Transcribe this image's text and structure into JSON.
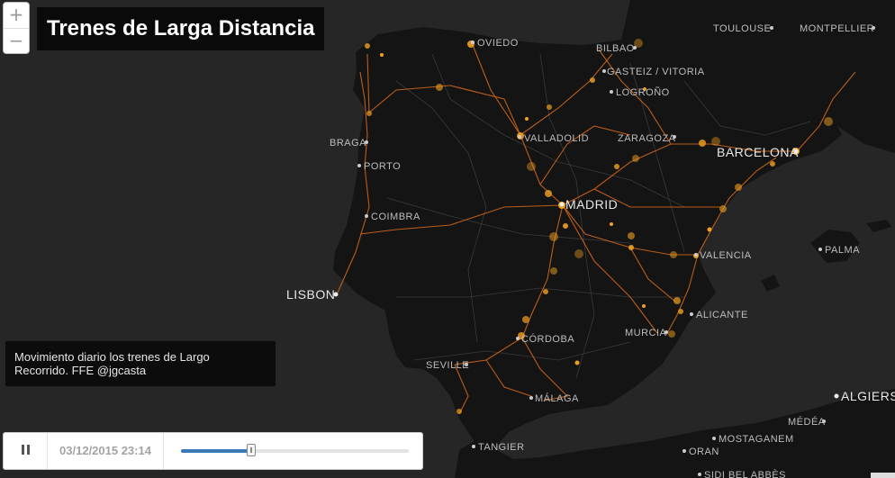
{
  "map": {
    "title": "Trenes de Larga Distancia",
    "caption": "Movimiento diario los trenes de Largo Recorrido. FFE @jgcasta",
    "colors": {
      "sea": "#262626",
      "land": "#141414",
      "railway": "#d96a1a",
      "train_dot": "#f0a020"
    },
    "cities": [
      {
        "name": "OVIEDO",
        "size": "normal"
      },
      {
        "name": "BILBAO",
        "size": "normal"
      },
      {
        "name": "GASTEIZ / VITORIA",
        "size": "normal"
      },
      {
        "name": "LOGROÑO",
        "size": "normal"
      },
      {
        "name": "TOULOUSE",
        "size": "normal"
      },
      {
        "name": "MONTPELLIER",
        "size": "normal"
      },
      {
        "name": "BRAGA",
        "size": "normal"
      },
      {
        "name": "PORTO",
        "size": "normal"
      },
      {
        "name": "VALLADOLID",
        "size": "normal"
      },
      {
        "name": "ZARAGOZA",
        "size": "normal"
      },
      {
        "name": "BARCELONA",
        "size": "big"
      },
      {
        "name": "MADRID",
        "size": "big"
      },
      {
        "name": "COIMBRA",
        "size": "normal"
      },
      {
        "name": "PALMA",
        "size": "normal"
      },
      {
        "name": "VALENCIA",
        "size": "normal"
      },
      {
        "name": "LISBON",
        "size": "big"
      },
      {
        "name": "ALICANTE",
        "size": "normal"
      },
      {
        "name": "CÓRDOBA",
        "size": "normal"
      },
      {
        "name": "MURCIA",
        "size": "normal"
      },
      {
        "name": "SEVILLE",
        "size": "normal"
      },
      {
        "name": "MÁLAGA",
        "size": "normal"
      },
      {
        "name": "ALGIERS",
        "size": "big"
      },
      {
        "name": "MÉDÉA",
        "size": "normal"
      },
      {
        "name": "TANGIER",
        "size": "normal"
      },
      {
        "name": "MOSTAGANEM",
        "size": "normal"
      },
      {
        "name": "ORAN",
        "size": "normal"
      },
      {
        "name": "SIDI BEL ABBÈS",
        "size": "normal"
      }
    ]
  },
  "zoom": {
    "in_icon": "+",
    "out_icon": "−"
  },
  "player": {
    "pause_icon": "pause-icon",
    "datetime": "03/12/2015 23:14",
    "day_progress": 0.31
  }
}
